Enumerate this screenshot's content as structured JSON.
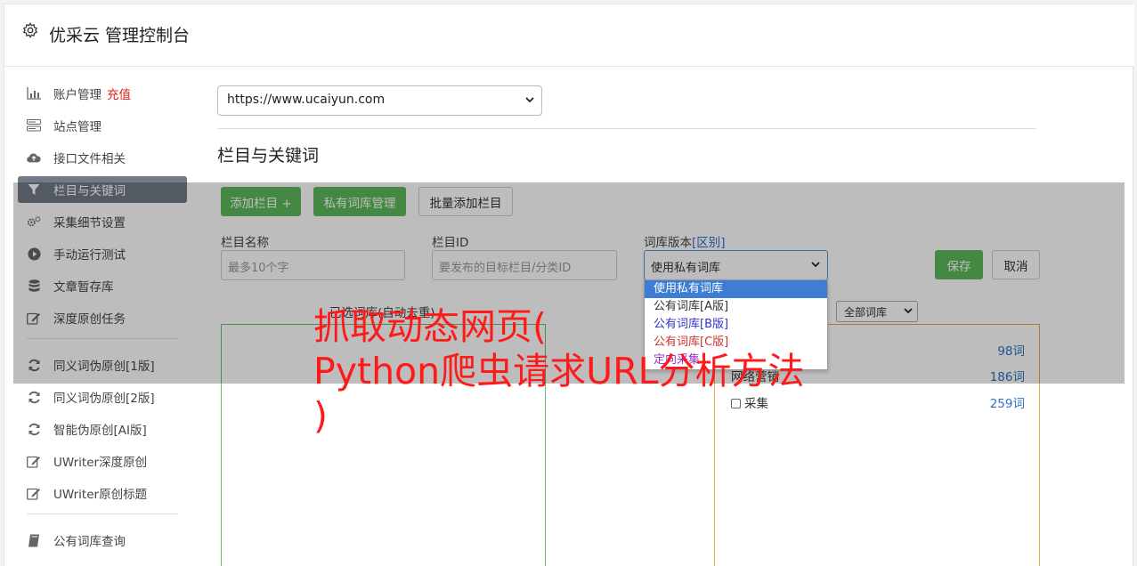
{
  "header": {
    "title": "优采云 管理控制台",
    "icon": "gear-icon"
  },
  "sidebar": {
    "items": [
      {
        "label": "账户管理",
        "icon": "bar-chart-icon",
        "badge": "充值"
      },
      {
        "label": "站点管理",
        "icon": "server-icon"
      },
      {
        "label": "接口文件相关",
        "icon": "cloud-upload-icon"
      },
      {
        "label": "栏目与关键词",
        "icon": "filter-icon",
        "active": true
      },
      {
        "label": "采集细节设置",
        "icon": "gears-icon"
      },
      {
        "label": "手动运行测试",
        "icon": "play-circle-icon"
      },
      {
        "label": "文章暂存库",
        "icon": "database-icon"
      },
      {
        "label": "深度原创任务",
        "icon": "edit-icon"
      }
    ],
    "items2": [
      {
        "label": "同义词伪原创[1版]",
        "icon": "refresh-icon"
      },
      {
        "label": "同义词伪原创[2版]",
        "icon": "refresh-icon"
      },
      {
        "label": "智能伪原创[AI版]",
        "icon": "refresh-icon"
      },
      {
        "label": "UWriter深度原创",
        "icon": "edit-icon"
      },
      {
        "label": "UWriter原创标题",
        "icon": "edit-icon"
      }
    ],
    "items3": [
      {
        "label": "公有词库查询",
        "icon": "book-icon"
      }
    ]
  },
  "main": {
    "site_select": "https://www.ucaiyun.com",
    "section_title": "栏目与关键词",
    "buttons": {
      "add_column": "添加栏目 +",
      "private_lib": "私有词库管理",
      "batch_add": "批量添加栏目",
      "save": "保存",
      "cancel": "取消"
    },
    "fields": {
      "column_name_label": "栏目名称",
      "column_name_placeholder": "最多10个字",
      "column_id_label": "栏目ID",
      "column_id_placeholder": "要发布的目标栏目/分类ID",
      "lib_version_label": "词库版本",
      "lib_version_link": "[区别]",
      "lib_version_value": "使用私有词库"
    },
    "dropdown_options": [
      {
        "label": "使用私有词库",
        "color": "#ffffff"
      },
      {
        "label": "公有词库[A版]",
        "color": "#333333"
      },
      {
        "label": "公有词库[B版]",
        "color": "#3333cc"
      },
      {
        "label": "公有词库[C版]",
        "color": "#cc3333"
      },
      {
        "label": "定向采集",
        "color": "#9933cc"
      }
    ],
    "panel_caption": "已选词库(自动去重)",
    "lib_filter": "全部词库",
    "lib_rows": [
      {
        "label": "",
        "count": "98词"
      },
      {
        "label": "网络营销",
        "count": "186词"
      },
      {
        "label": "采集",
        "count": "259词"
      }
    ]
  },
  "watermark": {
    "line1": "抓取动态网页(",
    "line2": "Python爬虫请求URL分析方法",
    "line3": ")"
  }
}
